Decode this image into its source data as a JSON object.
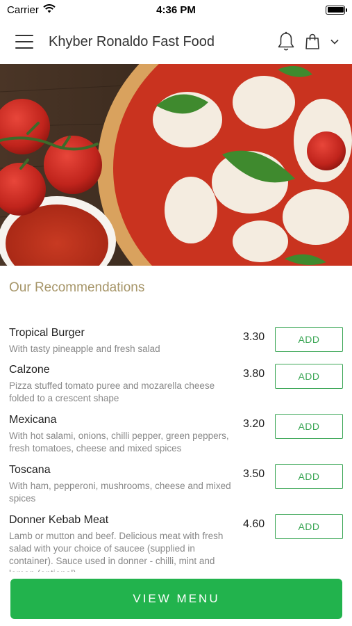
{
  "status_bar": {
    "carrier": "Carrier",
    "time": "4:36 PM"
  },
  "header": {
    "title": "Khyber Ronaldo Fast Food",
    "icons": [
      "menu-icon",
      "bell-icon",
      "shopping-bag-icon",
      "chevron-down-icon"
    ]
  },
  "hero": {
    "image": "pizza-margherita-photo"
  },
  "recommendations": {
    "title": "Our Recommendations",
    "add_label": "ADD",
    "items": [
      {
        "name": "Tropical Burger",
        "description": "With tasty pineapple and fresh salad",
        "price": "3.30"
      },
      {
        "name": "Calzone",
        "description": "Pizza stuffed tomato puree and mozarella cheese folded to a crescent shape",
        "price": "3.80"
      },
      {
        "name": "Mexicana",
        "description": "With hot salami, onions, chilli pepper, green peppers, fresh tomatoes, cheese and mixed spices",
        "price": "3.20"
      },
      {
        "name": "Toscana",
        "description": "With ham, pepperoni, mushrooms, cheese and mixed spices",
        "price": "3.50"
      },
      {
        "name": "Donner Kebab Meat",
        "description": "Lamb or mutton and beef. Delicious meat with fresh salad with your choice of saucee (supplied in container). Sauce used in donner - chilli, mint and lemon (optional)",
        "price": "4.60"
      }
    ]
  },
  "view_menu_label": "VIEW MENU",
  "colors": {
    "accent_green": "#22b34d",
    "section_title": "#a69568"
  }
}
